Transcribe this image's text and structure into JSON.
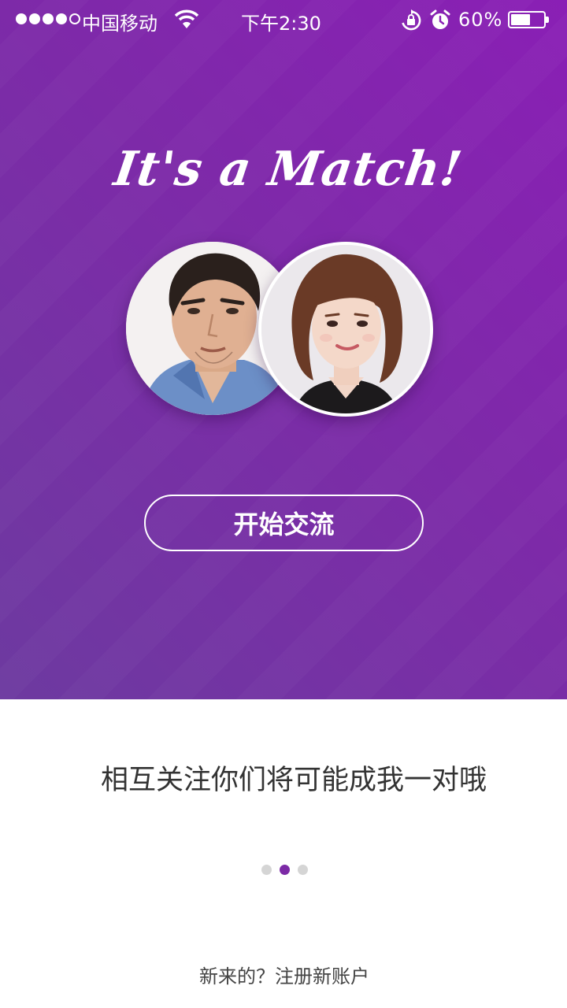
{
  "status_bar": {
    "carrier": "中国移动",
    "time": "下午2:30",
    "battery_percent_label": "60%",
    "battery_level": 0.6,
    "signal_bars": 4,
    "signal_total": 5,
    "icons": [
      "signal-icon",
      "wifi-icon",
      "rotation-lock-icon",
      "alarm-icon",
      "battery-icon"
    ]
  },
  "hero": {
    "title": "It's a Match!",
    "male_photo": "male-profile-photo",
    "female_photo": "female-profile-photo",
    "start_chat_label": "开始交流",
    "gradient_colors": [
      "#8a1fb5",
      "#6d3aa0"
    ]
  },
  "onboarding": {
    "caption": "相互关注你们将可能成我一对哦",
    "pager": {
      "count": 3,
      "active_index": 1
    },
    "register_link": "新来的？注册新账户",
    "accent_color": "#7c2aa6"
  }
}
